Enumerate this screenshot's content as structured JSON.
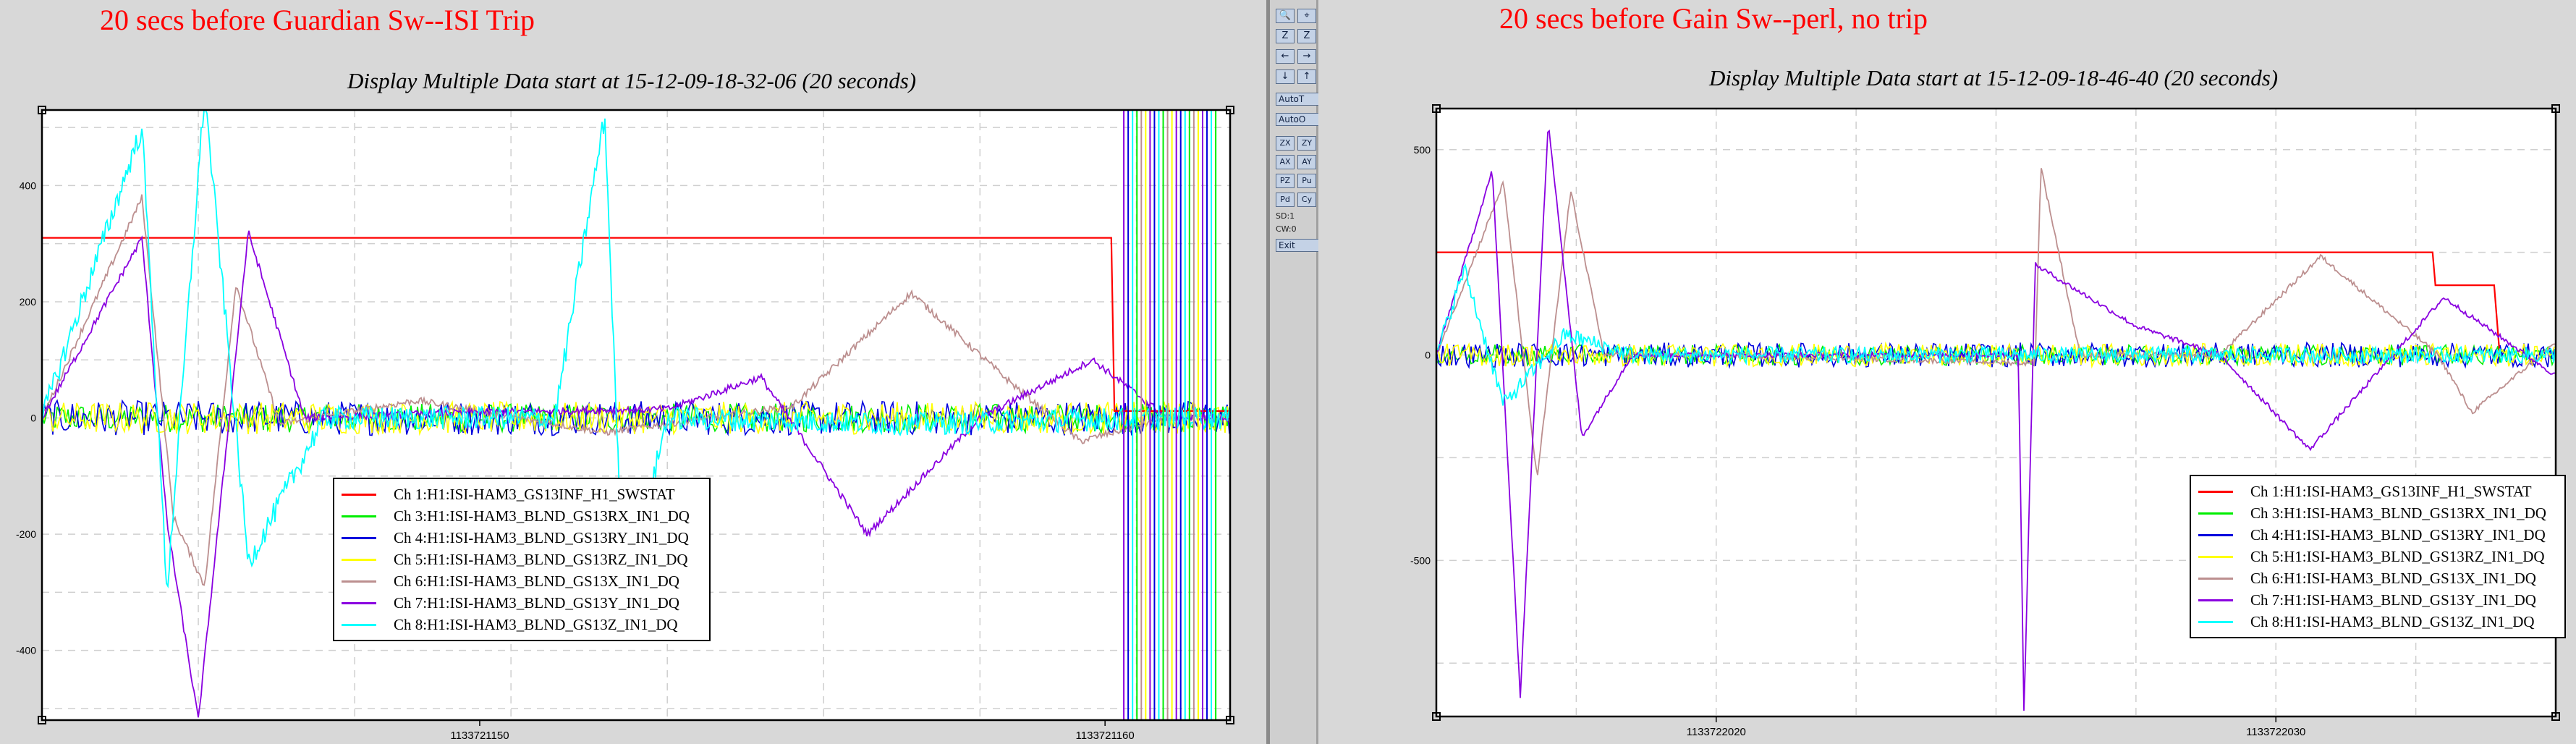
{
  "left": {
    "annotation": "20 secs before Guardian Sw--ISI Trip",
    "title": "Display Multiple Data start at 15-12-09-18-32-06 (20 seconds)",
    "x_tick_labels": [
      "1133721150",
      "1133721160"
    ],
    "y_tick_labels": [
      "400",
      "200",
      "0",
      "-200",
      "-400"
    ],
    "legend": [
      {
        "label": "Ch 1:H1:ISI-HAM3_GS13INF_H1_SWSTAT",
        "color": "#ff0000"
      },
      {
        "label": "Ch 3:H1:ISI-HAM3_BLND_GS13RX_IN1_DQ",
        "color": "#00ee00"
      },
      {
        "label": "Ch 4:H1:ISI-HAM3_BLND_GS13RY_IN1_DQ",
        "color": "#0000dd"
      },
      {
        "label": "Ch 5:H1:ISI-HAM3_BLND_GS13RZ_IN1_DQ",
        "color": "#ffff00"
      },
      {
        "label": "Ch 6:H1:ISI-HAM3_BLND_GS13X_IN1_DQ",
        "color": "#bc8f8f"
      },
      {
        "label": "Ch 7:H1:ISI-HAM3_BLND_GS13Y_IN1_DQ",
        "color": "#8a00e0"
      },
      {
        "label": "Ch 8:H1:ISI-HAM3_BLND_GS13Z_IN1_DQ",
        "color": "#00ffff"
      }
    ]
  },
  "right": {
    "annotation": "20 secs before Gain Sw--perl, no trip",
    "title": "Display Multiple Data start at 15-12-09-18-46-40 (20 seconds)",
    "x_tick_labels": [
      "1133722020",
      "1133722030"
    ],
    "y_tick_labels": [
      "500",
      "0",
      "-500"
    ],
    "legend": [
      {
        "label": "Ch 1:H1:ISI-HAM3_GS13INF_H1_SWSTAT",
        "color": "#ff0000"
      },
      {
        "label": "Ch 3:H1:ISI-HAM3_BLND_GS13RX_IN1_DQ",
        "color": "#00ee00"
      },
      {
        "label": "Ch 4:H1:ISI-HAM3_BLND_GS13RY_IN1_DQ",
        "color": "#0000dd"
      },
      {
        "label": "Ch 5:H1:ISI-HAM3_BLND_GS13RZ_IN1_DQ",
        "color": "#ffff00"
      },
      {
        "label": "Ch 6:H1:ISI-HAM3_BLND_GS13X_IN1_DQ",
        "color": "#bc8f8f"
      },
      {
        "label": "Ch 7:H1:ISI-HAM3_BLND_GS13Y_IN1_DQ",
        "color": "#8a00e0"
      },
      {
        "label": "Ch 8:H1:ISI-HAM3_BLND_GS13Z_IN1_DQ",
        "color": "#00ffff"
      }
    ]
  },
  "controls": {
    "buttons": [
      "AutoT",
      "AutoO",
      "Exit"
    ],
    "grid_buttons": [
      "ZX",
      "ZY",
      "AX",
      "AY",
      "PZ",
      "Pu",
      "Pd",
      "Cy"
    ],
    "icon_buttons": [
      "zoom-in-icon",
      "zoom-xy-icon",
      "zoom-z-icon",
      "zoom-z2-icon",
      "arrow-left-icon",
      "arrow-right-icon",
      "arrow-down-icon",
      "arrow-up-icon"
    ],
    "status": [
      "SD:1",
      "CW:0"
    ]
  },
  "chart_data": [
    {
      "type": "line",
      "title": "Display Multiple Data start at 15-12-09-18-32-06 (20 seconds)",
      "xlabel": "",
      "ylabel": "",
      "xlim": [
        1133721143,
        1133721162
      ],
      "ylim": [
        -520,
        530
      ],
      "x_ticks": [
        1133721150,
        1133721160
      ],
      "y_ticks": [
        400,
        200,
        0,
        -200,
        -400
      ],
      "grid": true,
      "legend_position": "bottom-center",
      "series": [
        {
          "name": "Ch 1:H1:ISI-HAM3_GS13INF_H1_SWSTAT",
          "color": "#ff0000",
          "x": [
            1133721143,
            1133721160.1,
            1133721160.15,
            1133721162
          ],
          "y": [
            310,
            310,
            12,
            12
          ]
        },
        {
          "name": "Ch 6:H1:ISI-HAM3_BLND_GS13X_IN1_DQ",
          "color": "#bc8f8f",
          "x": [
            1133721143,
            1133721144.6,
            1133721145.1,
            1133721145.6,
            1133721146.1,
            1133721146.8,
            1133721149,
            1133721152,
            1133721155,
            1133721156.9,
            1133721158.5,
            1133721159.6,
            1133721161
          ],
          "y": [
            0,
            380,
            -170,
            -290,
            230,
            -10,
            30,
            -25,
            20,
            215,
            60,
            -40,
            0
          ]
        },
        {
          "name": "Ch 7:H1:ISI-HAM3_BLND_GS13Y_IN1_DQ",
          "color": "#8a00e0",
          "x": [
            1133721143,
            1133721144.6,
            1133721145.0,
            1133721145.5,
            1133721146.3,
            1133721147.2,
            1133721150,
            1133721153,
            1133721154.5,
            1133721156.2,
            1133721158,
            1133721159.8,
            1133721161
          ],
          "y": [
            0,
            310,
            -180,
            -520,
            320,
            0,
            10,
            15,
            70,
            -200,
            0,
            100,
            0
          ]
        },
        {
          "name": "Ch 8:H1:ISI-HAM3_BLND_GS13Z_IN1_DQ",
          "color": "#00ffff",
          "x": [
            1133721143,
            1133721144.6,
            1133721145.0,
            1133721145.6,
            1133721146.3,
            1133721147.5,
            1133721151.2,
            1133721152.0,
            1133721152.3,
            1133721153,
            1133721157,
            1133721161
          ],
          "y": [
            0,
            500,
            -300,
            560,
            -250,
            0,
            0,
            520,
            -320,
            0,
            -10,
            0
          ]
        }
      ]
    },
    {
      "type": "line",
      "title": "Display Multiple Data start at 15-12-09-18-46-40 (20 seconds)",
      "xlabel": "",
      "ylabel": "",
      "xlim": [
        1133722015,
        1133722035
      ],
      "ylim": [
        -880,
        600
      ],
      "x_ticks": [
        1133722020,
        1133722030
      ],
      "y_ticks": [
        500,
        0,
        -500
      ],
      "grid": true,
      "legend_position": "bottom-right",
      "series": [
        {
          "name": "Ch 1:H1:ISI-HAM3_GS13INF_H1_SWSTAT",
          "color": "#ff0000",
          "x": [
            1133722015,
            1133722032.8,
            1133722032.85,
            1133722033.9,
            1133722034.0
          ],
          "y": [
            250,
            250,
            170,
            170,
            0
          ]
        },
        {
          "name": "Ch 6:H1:ISI-HAM3_BLND_GS13X_IN1_DQ",
          "color": "#bc8f8f",
          "x": [
            1133722015,
            1133722016.2,
            1133722016.8,
            1133722017.4,
            1133722018,
            1133722020,
            1133722025.7,
            1133722025.8,
            1133722026.5,
            1133722029,
            1133722030.8,
            1133722032.9,
            1133722033.5,
            1133722035
          ],
          "y": [
            0,
            420,
            -300,
            400,
            0,
            0,
            -20,
            460,
            0,
            0,
            240,
            0,
            -140,
            30
          ]
        },
        {
          "name": "Ch 7:H1:ISI-HAM3_BLND_GS13Y_IN1_DQ",
          "color": "#8a00e0",
          "x": [
            1133722015,
            1133722016.0,
            1133722016.5,
            1133722017.0,
            1133722017.6,
            1133722018.5,
            1133722025.4,
            1133722025.5,
            1133722025.7,
            1133722027.5,
            1133722029,
            1133722030.6,
            1133722033,
            1133722035
          ],
          "y": [
            0,
            450,
            -830,
            570,
            -200,
            0,
            0,
            -880,
            220,
            70,
            0,
            -230,
            140,
            -50
          ]
        },
        {
          "name": "Ch 8:H1:ISI-HAM3_BLND_GS13Z_IN1_DQ",
          "color": "#00ffff",
          "x": [
            1133722015,
            1133722015.5,
            1133722016.2,
            1133722017.3,
            1133722018.5,
            1133722025,
            1133722030,
            1133722035
          ],
          "y": [
            0,
            210,
            -120,
            50,
            0,
            0,
            0,
            0
          ]
        }
      ]
    }
  ]
}
